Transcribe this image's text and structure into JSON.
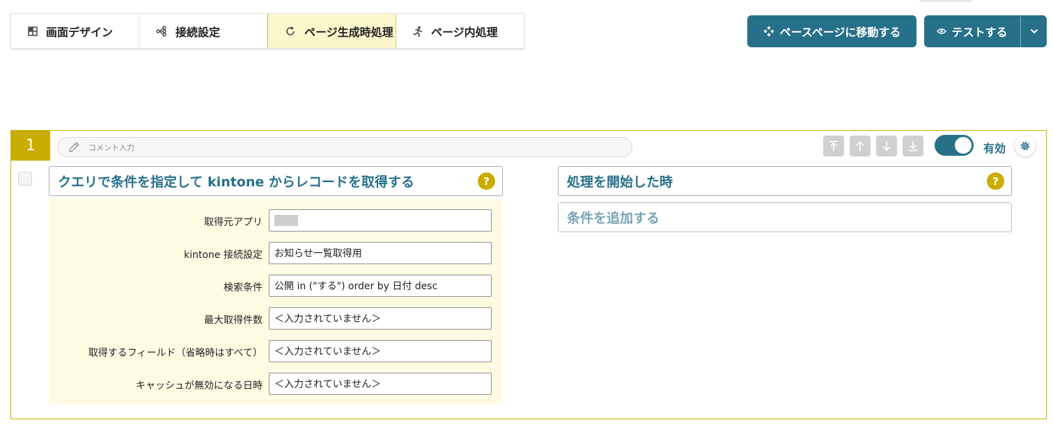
{
  "tabs": [
    {
      "label": "画面デザイン",
      "icon": "layout-icon"
    },
    {
      "label": "接続設定",
      "icon": "connection-icon"
    },
    {
      "label": "ページ生成時処理",
      "icon": "refresh-icon",
      "active": true
    },
    {
      "label": "ページ内処理",
      "icon": "running-icon"
    }
  ],
  "toolbar": {
    "base_page_label": "ペースページに移動する",
    "test_label": "テストする"
  },
  "step": {
    "number": "1",
    "comment_placeholder": "コメント入力",
    "enabled": true,
    "enabled_label": "有効",
    "action": {
      "title": "クエリで条件を指定して kintone からレコードを取得する",
      "help": "?",
      "params": [
        {
          "label": "取得元アプリ",
          "value": ""
        },
        {
          "label": "kintone 接続設定",
          "value": "お知らせ一覧取得用"
        },
        {
          "label": "検索条件",
          "value": "公開 in (\"する\") order by 日付 desc"
        },
        {
          "label": "最大取得件数",
          "value": "＜入力されていません＞"
        },
        {
          "label": "取得するフィールド（省略時はすべて）",
          "value": "＜入力されていません＞"
        },
        {
          "label": "キャッシュが無効になる日時",
          "value": "＜入力されていません＞"
        }
      ]
    },
    "trigger": {
      "title": "処理を開始した時",
      "help": "?",
      "add_condition_label": "条件を追加する"
    }
  },
  "colors": {
    "accent": "#27708a",
    "gold": "#c9ad00",
    "active_tab_bg": "#fcf6cc",
    "params_bg": "#fefbe3"
  }
}
